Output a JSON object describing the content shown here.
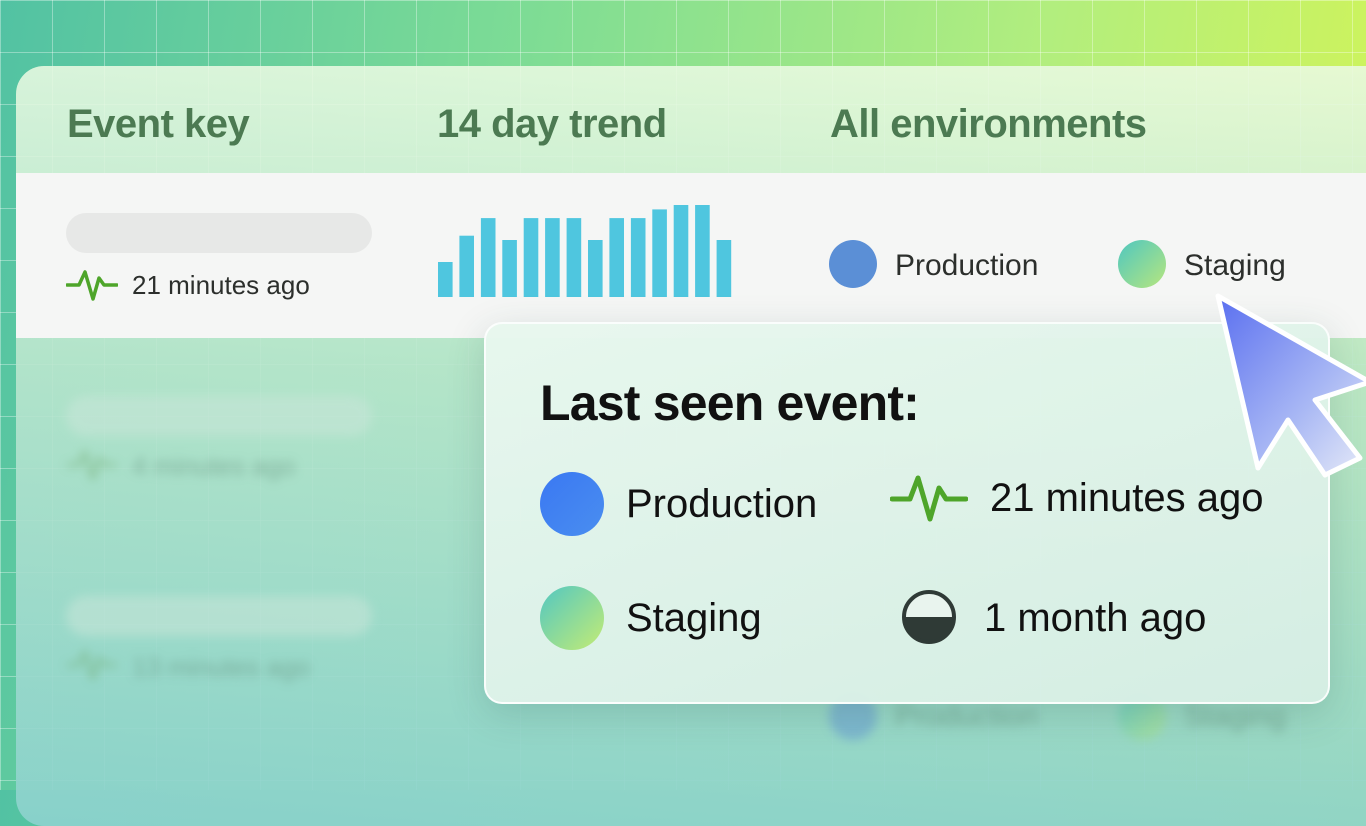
{
  "header": {
    "col_event_key": "Event key",
    "col_trend": "14 day trend",
    "col_env": "All environments"
  },
  "rows": [
    {
      "last_seen": "21 minutes ago",
      "trend": [
        8,
        14,
        18,
        13,
        18,
        18,
        18,
        13,
        18,
        18,
        20,
        21,
        21,
        13
      ],
      "environments": [
        "Production",
        "Staging"
      ]
    },
    {
      "last_seen": "4 minutes ago"
    },
    {
      "last_seen": "13 minutes ago",
      "environments": [
        "Production",
        "Staging"
      ]
    }
  ],
  "tooltip": {
    "title": "Last seen event:",
    "entries": [
      {
        "env": "Production",
        "time": "21 minutes ago",
        "icon": "activity-icon"
      },
      {
        "env": "Staging",
        "time": "1 month ago",
        "icon": "half-circle-icon"
      }
    ]
  },
  "colors": {
    "accent_green": "#4ea52a",
    "trend_bar": "#4fc6df",
    "header_text": "#4c7a52",
    "production": "#5b8fd6"
  }
}
